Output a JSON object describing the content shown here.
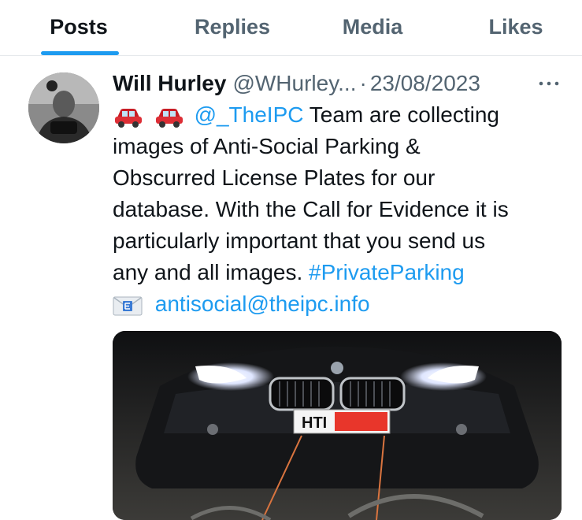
{
  "tabs": [
    {
      "label": "Posts",
      "active": true
    },
    {
      "label": "Replies",
      "active": false
    },
    {
      "label": "Media",
      "active": false
    },
    {
      "label": "Likes",
      "active": false
    }
  ],
  "post": {
    "author_name": "Will Hurley",
    "handle": "@WHurley...",
    "separator": "·",
    "date": "23/08/2023",
    "more_icon": "more-horizontal-icon",
    "mention": "@_TheIPC",
    "line1_rest": " Team are collecting",
    "line2": "images of Anti-Social Parking &",
    "line3": "Obscurred License Plates for our",
    "line4": "database. With the Call for Evidence it is",
    "line5": "particularly important that you send us",
    "line6_text": "any and all images. ",
    "hashtag": "#PrivateParking",
    "email": "antisocial@theipc.info",
    "media": {
      "plate_text": "HTI"
    }
  },
  "colors": {
    "accent": "#1d9bf0",
    "text": "#0f1419",
    "muted": "#536471",
    "redaction": "#e8362b"
  }
}
